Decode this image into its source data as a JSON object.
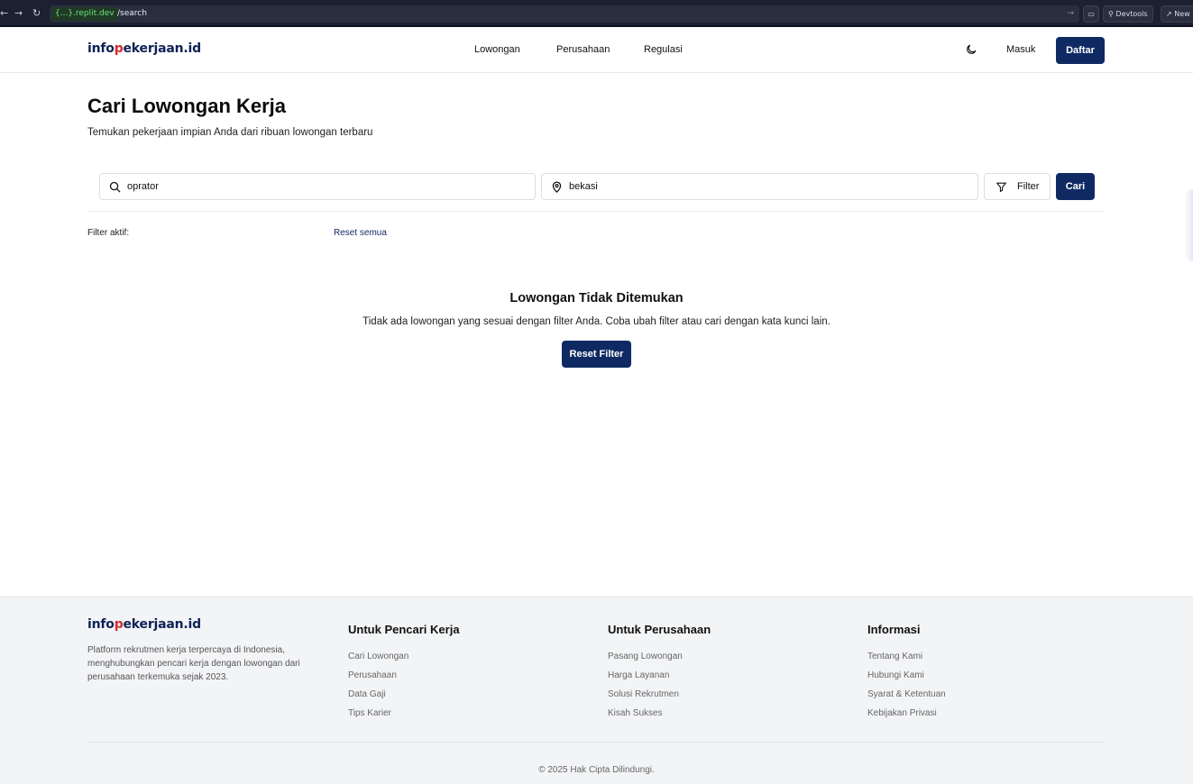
{
  "browser": {
    "host": "{...}.replit.dev",
    "path": "/search",
    "devtools_label": "Devtools",
    "new_label": "New"
  },
  "header": {
    "logo_pre": "info",
    "logo_accent_1": "p",
    "logo_mid": "ekerj",
    "logo_accent_2": "",
    "logo_post": "aan.id",
    "nav": [
      "Lowongan",
      "Perusahaan",
      "Regulasi"
    ],
    "login_label": "Masuk",
    "register_label": "Daftar"
  },
  "main": {
    "title": "Cari Lowongan Kerja",
    "subtitle": "Temukan pekerjaan impian Anda dari ribuan lowongan terbaru",
    "search": {
      "keyword_value": "oprator",
      "location_value": "bekasi",
      "filter_label": "Filter",
      "search_label": "Cari"
    },
    "active_filter_label": "Filter aktif:",
    "reset_all_label": "Reset semua",
    "empty_title": "Lowongan Tidak Ditemukan",
    "empty_desc": "Tidak ada lowongan yang sesuai dengan filter Anda. Coba ubah filter atau cari dengan kata kunci lain.",
    "reset_filter_label": "Reset Filter"
  },
  "footer": {
    "description": "Platform rekrutmen kerja terpercaya di Indonesia, menghubungkan pencari kerja dengan lowongan dari perusahaan terkemuka sejak 2023.",
    "columns": [
      {
        "heading": "Untuk Pencari Kerja",
        "links": [
          "Cari Lowongan",
          "Perusahaan",
          "Data Gaji",
          "Tips Karier"
        ]
      },
      {
        "heading": "Untuk Perusahaan",
        "links": [
          "Pasang Lowongan",
          "Harga Layanan",
          "Solusi Rekrutmen",
          "Kisah Sukses"
        ]
      },
      {
        "heading": "Informasi",
        "links": [
          "Tentang Kami",
          "Hubungi Kami",
          "Syarat & Ketentuan",
          "Kebijakan Privasi"
        ]
      }
    ],
    "copyright": "© 2025 Hak Cipta Dilindungi."
  },
  "colors": {
    "primary": "#0f2a63",
    "logo_accent": "#d52b2b",
    "footer_bg": "#f3f4f6"
  },
  "icons": [
    "back-arrow-icon",
    "forward-arrow-icon",
    "reload-icon",
    "moon-icon",
    "search-icon",
    "map-pin-icon",
    "filter-icon"
  ]
}
